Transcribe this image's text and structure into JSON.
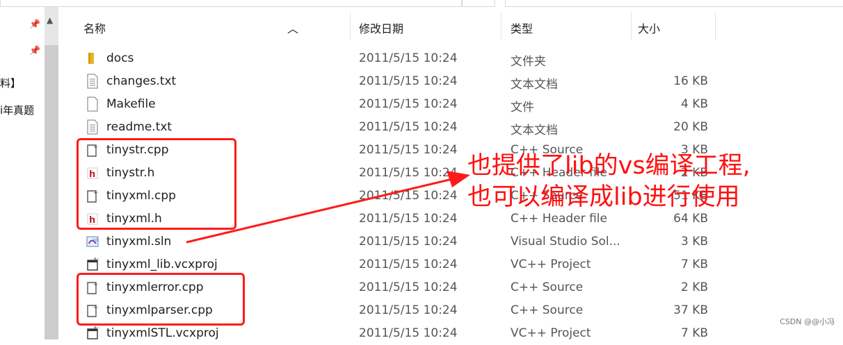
{
  "nav": {
    "items": [
      {
        "label": ""
      },
      {
        "label": ""
      },
      {
        "label": "料】"
      },
      {
        "label": "i年真题"
      }
    ]
  },
  "columns": {
    "name": "名称",
    "modified": "修改日期",
    "type": "类型",
    "size": "大小"
  },
  "files": [
    {
      "name": "docs",
      "date": "2011/5/15 10:24",
      "type": "文件夹",
      "size": "",
      "icon": "folder-icon"
    },
    {
      "name": "changes.txt",
      "date": "2011/5/15 10:24",
      "type": "文本文档",
      "size": "16 KB",
      "icon": "text-file-icon"
    },
    {
      "name": "Makefile",
      "date": "2011/5/15 10:24",
      "type": "文件",
      "size": "4 KB",
      "icon": "file-icon"
    },
    {
      "name": "readme.txt",
      "date": "2011/5/15 10:24",
      "type": "文本文档",
      "size": "20 KB",
      "icon": "text-file-icon"
    },
    {
      "name": "tinystr.cpp",
      "date": "2011/5/15 10:24",
      "type": "C++ Source",
      "size": "3 KB",
      "icon": "cpp-file-icon"
    },
    {
      "name": "tinystr.h",
      "date": "2011/5/15 10:24",
      "type": "C++ Header file",
      "size": "2 KB",
      "icon": "header-file-icon"
    },
    {
      "name": "tinyxml.cpp",
      "date": "2011/5/15 10:24",
      "type": "C++ Source",
      "size": "51 KB",
      "icon": "cpp-file-icon"
    },
    {
      "name": "tinyxml.h",
      "date": "2011/5/15 10:24",
      "type": "C++ Header file",
      "size": "64 KB",
      "icon": "header-file-icon"
    },
    {
      "name": "tinyxml.sln",
      "date": "2011/5/15 10:24",
      "type": "Visual Studio Sol...",
      "size": "3 KB",
      "icon": "solution-file-icon"
    },
    {
      "name": "tinyxml_lib.vcxproj",
      "date": "2011/5/15 10:24",
      "type": "VC++ Project",
      "size": "7 KB",
      "icon": "project-file-icon"
    },
    {
      "name": "tinyxmlerror.cpp",
      "date": "2011/5/15 10:24",
      "type": "C++ Source",
      "size": "2 KB",
      "icon": "cpp-file-icon"
    },
    {
      "name": "tinyxmlparser.cpp",
      "date": "2011/5/15 10:24",
      "type": "C++ Source",
      "size": "37 KB",
      "icon": "cpp-file-icon"
    },
    {
      "name": "tinyxmlSTL.vcxproj",
      "date": "2011/5/15 10:24",
      "type": "VC++ Project",
      "size": "7 KB",
      "icon": "project-file-icon"
    }
  ],
  "annotation": {
    "line1": "也提供了lib的vs编译工程,",
    "line2": "也可以编译成lib进行使用",
    "color": "#ff1010"
  },
  "watermark": "CSDN @@小冯"
}
